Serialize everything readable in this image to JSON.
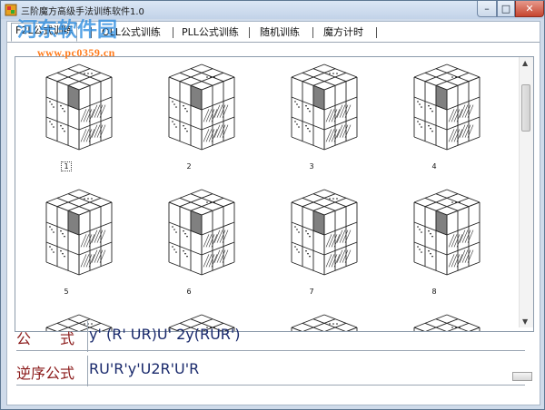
{
  "window": {
    "title": "三阶魔方高级手法训练软件1.0",
    "close_glyph": "✕",
    "minimize_glyph": "–",
    "maximize_glyph": "□"
  },
  "watermark": {
    "text": "河东软件园",
    "url": "www.pc0359.cn"
  },
  "tabs": [
    {
      "label": "F2L公式训练",
      "active": true
    },
    {
      "label": "OLL公式训练",
      "active": false
    },
    {
      "label": "PLL公式训练",
      "active": false
    },
    {
      "label": "随机训练",
      "active": false
    },
    {
      "label": "魔方计时",
      "active": false
    }
  ],
  "cubes": [
    {
      "label": "1"
    },
    {
      "label": "2"
    },
    {
      "label": "3"
    },
    {
      "label": "4"
    },
    {
      "label": "5"
    },
    {
      "label": "6"
    },
    {
      "label": "7"
    },
    {
      "label": "8"
    }
  ],
  "formula": {
    "label": "公　　式",
    "value": "y'  (R'  UR)U'  2y(RUR')"
  },
  "reverse_formula": {
    "label": "逆序公式",
    "value": "RU'R'y'U2R'U'R"
  },
  "scrollbar": {
    "up_glyph": "▲",
    "down_glyph": "▼"
  },
  "colors": {
    "label_red": "#8b1a1a",
    "formula_blue": "#1a2a6c",
    "highlight_gray": "#808080"
  }
}
